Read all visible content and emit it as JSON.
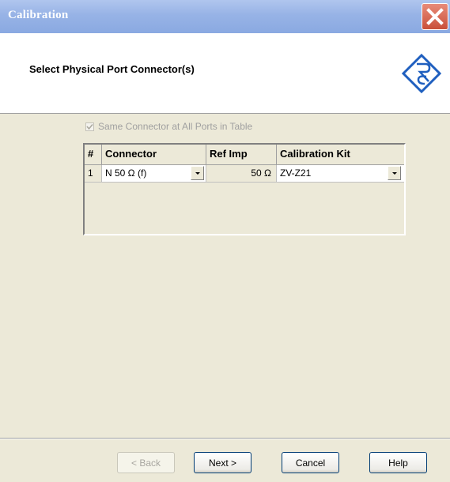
{
  "window": {
    "title": "Calibration"
  },
  "header": {
    "title": "Select Physical Port Connector(s)"
  },
  "options": {
    "same_connector_label": "Same Connector at All Ports in Table",
    "same_connector_checked": true
  },
  "table": {
    "headers": [
      "#",
      "Connector",
      "Ref Imp",
      "Calibration Kit"
    ],
    "rows": [
      {
        "index": "1",
        "connector": "N 50 Ω (f)",
        "ref_imp": "50 Ω",
        "cal_kit": "ZV-Z21"
      }
    ]
  },
  "buttons": {
    "back": "< Back",
    "next": "Next >",
    "cancel": "Cancel",
    "help": "Help"
  }
}
